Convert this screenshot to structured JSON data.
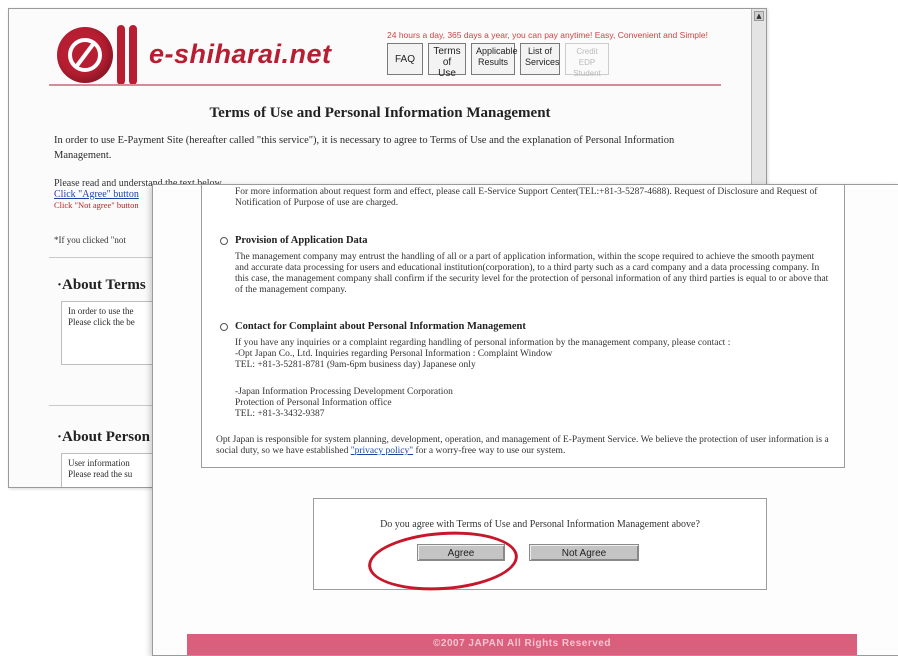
{
  "back_window": {
    "logo_text": "e-shiharai.net",
    "tagline": "24 hours a day, 365 days a year, you can pay anytime! Easy, Convenient and Simple!",
    "nav": [
      {
        "label": "FAQ"
      },
      {
        "label": "Terms of Use"
      },
      {
        "label": "Applicable Results"
      },
      {
        "label": "List of Services"
      },
      {
        "label": "Credit EDP Student"
      }
    ],
    "page_title": "Terms of Use and Personal Information Management",
    "intro": "In order to use E-Payment Site (hereafter called \"this service\"), it is necessary to agree to Terms of Use and the explanation of Personal Information Management.",
    "please_read": "Please read and understand the text below.",
    "click_agree": "Click \"Agree\" button",
    "click_not_agree": "Click \"Not agree\" button",
    "if_clicked": "*If you clicked \"not",
    "section1": {
      "heading": "·About Terms",
      "line1": "In order to use the",
      "line2": "Please click the be"
    },
    "section2": {
      "heading": "·About Person",
      "line1": "User information",
      "line2": "Please read the su"
    }
  },
  "front_window": {
    "top_text": "For more information about request form and effect, please call E-Service Support Center(TEL:+81-3-5287-4688). Request of Disclosure and Request of Notification of Purpose of use are charged.",
    "provision": {
      "title": "Provision of Application Data",
      "body": "The management company may entrust the handling of all or a part of application information, within the scope required to achieve the smooth payment and accurate data processing for users and educational institution(corporation), to a third party such as a card company and a data processing company. In this case, the management company shall confirm if the security level for the protection of personal information of any third parties is equal to or above that of the management company."
    },
    "contact": {
      "title": "Contact for Complaint about Personal Information Management",
      "line1": "If you have any inquiries or a complaint regarding handling of personal information by the management company, please contact :",
      "line2": "-Opt Japan Co., Ltd. Inquiries regarding Personal Information : Complaint Window",
      "line3": "TEL: +81-3-5281-8781 (9am-6pm business day) Japanese only",
      "line4": "-Japan Information Processing Development Corporation",
      "line5": "Protection of Personal Information office",
      "line6": "TEL: +81-3-3432-9387"
    },
    "opt_japan_pre": "Opt Japan is responsible for system planning, development, operation, and management of E-Payment Service. We believe the protection of user information is a social duty, so we have established ",
    "privacy_policy": "\"privacy policy\"",
    "opt_japan_post": " for a worry-free way to use our system.",
    "question": "Do you agree with Terms of Use and Personal Information Management above?",
    "agree_label": "Agree",
    "not_agree_label": "Not Agree",
    "footer": "©2007 JAPAN All Rights Reserved"
  },
  "colors": {
    "brand": "#b81e32",
    "footer": "#d95f7c",
    "annotation": "#c8162a"
  }
}
